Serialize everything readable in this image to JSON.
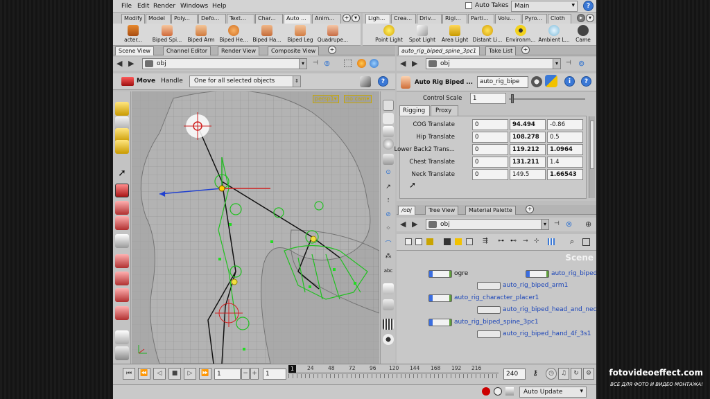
{
  "watermark": {
    "site": "fotovideoeffect.com",
    "tagline": "ВСЕ ДЛЯ ФОТО И ВИДЕО МОНТАЖА!"
  },
  "menu": {
    "items": [
      "File",
      "Edit",
      "Render",
      "Windows",
      "Help"
    ],
    "auto_takes": "Auto Takes",
    "desktop": "Main"
  },
  "shelf_left": {
    "tabs": [
      "Modify",
      "Model",
      "Poly...",
      "Defo...",
      "Text...",
      "Char...",
      "Auto ...",
      "Anim..."
    ]
  },
  "shelf_right": {
    "tabs": [
      "Ligh...",
      "Crea...",
      "Driv...",
      "Rigi...",
      "Parti...",
      "Volu...",
      "Pyro...",
      "Cloth"
    ]
  },
  "tools_left": [
    "acter...",
    "Biped Spi...",
    "Biped Arm",
    "Biped He...",
    "Biped Ha...",
    "Biped Leg",
    "Quadrupe..."
  ],
  "tools_right": [
    "Point Light",
    "Spot Light",
    "Area Light",
    "Distant Li...",
    "Environm...",
    "Ambient L...",
    "Came"
  ],
  "left_pane": {
    "tabs": [
      "Scene View",
      "Channel Editor",
      "Render View",
      "Composite View"
    ],
    "path": "obj",
    "move_label": "Move",
    "handle_label": "Handle",
    "handle_option": "One for all selected objects",
    "cam_persp": "persp1▾",
    "cam_nocam": "no cam▾"
  },
  "right_top": {
    "tabs": [
      "auto_rig_biped_spine_3pc1",
      "Take List"
    ],
    "path": "obj",
    "node_type": "Auto Rig Biped ...",
    "node_name": "auto_rig_bipe",
    "control_scale_label": "Control Scale",
    "control_scale_value": "1",
    "subtabs": [
      "Rigging",
      "Proxy"
    ],
    "params": [
      {
        "label": "COG Translate",
        "x": "0",
        "y": "94.494",
        "z": "-0.86",
        "yb": true,
        "zb": false
      },
      {
        "label": "Hip Translate",
        "x": "0",
        "y": "108.278",
        "z": "0.5",
        "yb": true,
        "zb": false
      },
      {
        "label": "Lower Back2 Trans...",
        "x": "0",
        "y": "119.212",
        "z": "1.0964",
        "yb": true,
        "zb": true
      },
      {
        "label": "Chest Translate",
        "x": "0",
        "y": "131.211",
        "z": "1.4",
        "yb": true,
        "zb": false
      },
      {
        "label": "Neck Translate",
        "x": "0",
        "y": "149.5",
        "z": "1.66543",
        "yb": false,
        "zb": true
      }
    ]
  },
  "right_bottom": {
    "tabs": [
      "/obj",
      "Tree View",
      "Material Palette"
    ],
    "path": "obj",
    "scene_label": "Scene",
    "nodes": [
      "ogre",
      "auto_rig_biped",
      "auto_rig_biped_arm1",
      "auto_rig_character_placer1",
      "auto_rig_biped_head_and_neck",
      "auto_rig_biped_spine_3pc1",
      "auto_rig_biped_hand_4f_3s1"
    ]
  },
  "timeline": {
    "frame": "1",
    "start": "1",
    "end": "240",
    "current": "1",
    "ticks": [
      "24",
      "48",
      "72",
      "96",
      "120",
      "144",
      "168",
      "192",
      "216"
    ]
  },
  "status": {
    "update_mode": "Auto Update"
  },
  "colors": {
    "accent_blue": "#3a78d6",
    "wire_green": "#33cc33",
    "handle_red": "#d02020"
  }
}
